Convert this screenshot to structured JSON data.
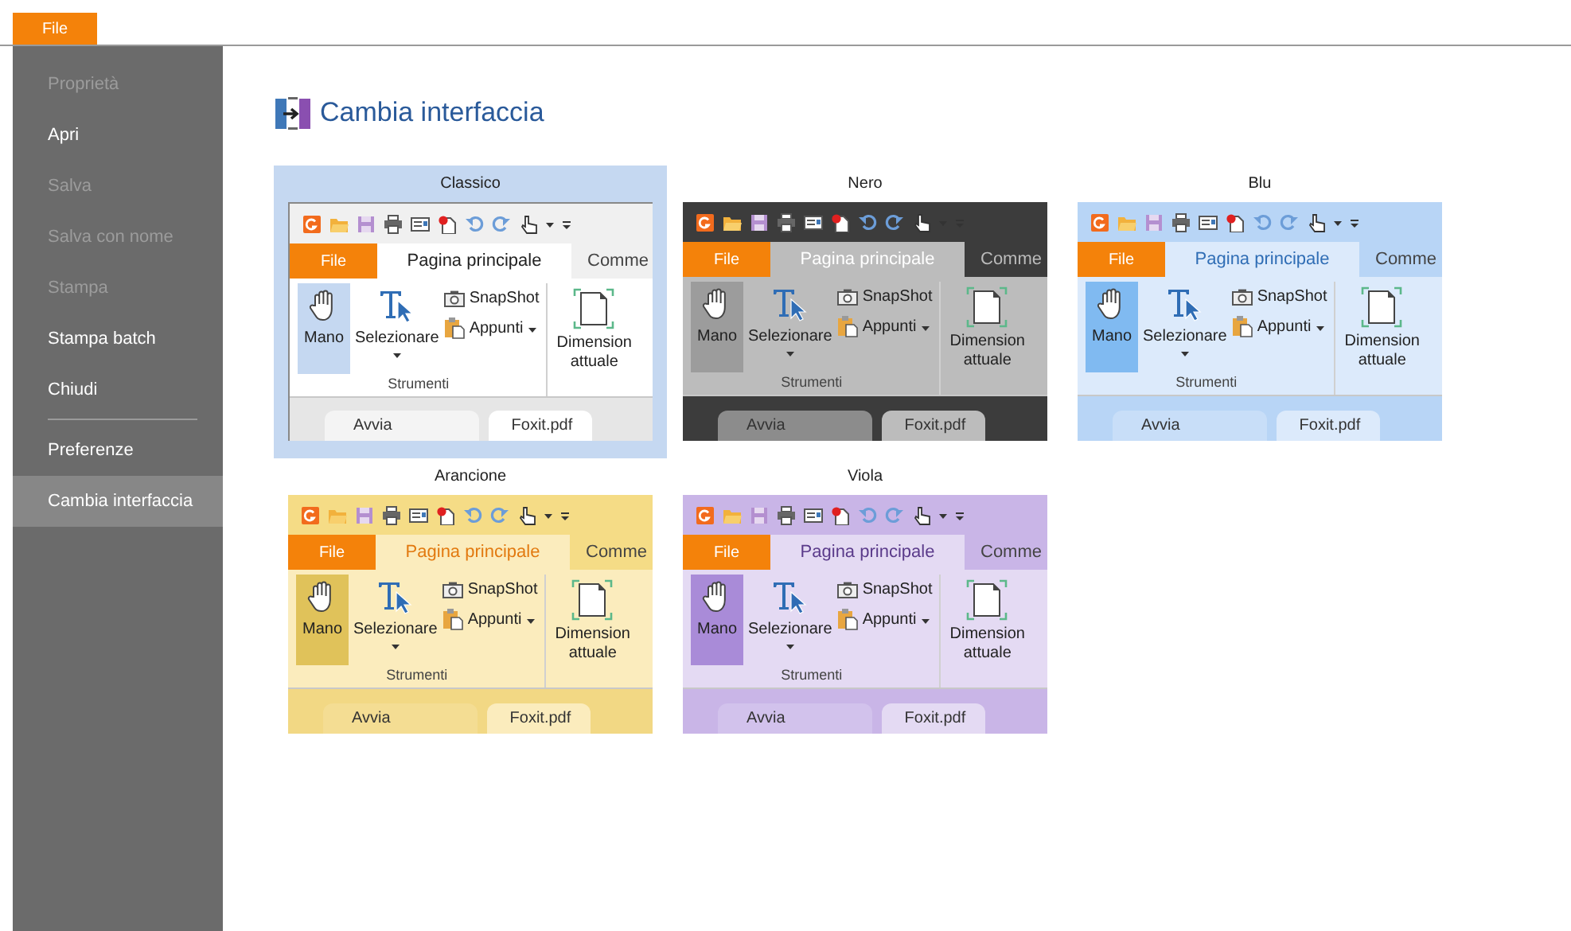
{
  "menu_tab": {
    "label": "File"
  },
  "sidebar": {
    "items": [
      {
        "label": "Proprietà",
        "disabled": true,
        "selected": false,
        "divider_before": false
      },
      {
        "label": "Apri",
        "disabled": false,
        "selected": false,
        "divider_before": false
      },
      {
        "label": "Salva",
        "disabled": true,
        "selected": false,
        "divider_before": false
      },
      {
        "label": "Salva con nome",
        "disabled": true,
        "selected": false,
        "divider_before": false
      },
      {
        "label": "Stampa",
        "disabled": true,
        "selected": false,
        "divider_before": false
      },
      {
        "label": "Stampa batch",
        "disabled": false,
        "selected": false,
        "divider_before": false
      },
      {
        "label": "Chiudi",
        "disabled": false,
        "selected": false,
        "divider_before": false
      },
      {
        "label": "Preferenze",
        "disabled": false,
        "selected": false,
        "divider_before": true
      },
      {
        "label": "Cambia interfaccia",
        "disabled": false,
        "selected": true,
        "divider_before": false
      }
    ]
  },
  "page_title": "Cambia interfaccia",
  "themes": [
    {
      "name": "Classico",
      "kind": "classic",
      "selected": true,
      "preview": {
        "file_tab": "File",
        "home_tab": "Pagina principale",
        "next_tab": "Comme",
        "hand": "Mano",
        "select": "Selezionare",
        "snapshot": "SnapShot",
        "clipboard": "Appunti",
        "group": "Strumenti",
        "actual_size": "Dimension\nattuale",
        "doc_tabs": [
          "Avvia",
          "Foxit.pdf"
        ]
      }
    },
    {
      "name": "Nero",
      "kind": "black",
      "selected": false,
      "preview": {
        "file_tab": "File",
        "home_tab": "Pagina principale",
        "next_tab": "Comme",
        "hand": "Mano",
        "select": "Selezionare",
        "snapshot": "SnapShot",
        "clipboard": "Appunti",
        "group": "Strumenti",
        "actual_size": "Dimension\nattuale",
        "doc_tabs": [
          "Avvia",
          "Foxit.pdf"
        ]
      }
    },
    {
      "name": "Blu",
      "kind": "blue",
      "selected": false,
      "preview": {
        "file_tab": "File",
        "home_tab": "Pagina principale",
        "next_tab": "Comme",
        "hand": "Mano",
        "select": "Selezionare",
        "snapshot": "SnapShot",
        "clipboard": "Appunti",
        "group": "Strumenti",
        "actual_size": "Dimension\nattuale",
        "doc_tabs": [
          "Avvia",
          "Foxit.pdf"
        ]
      }
    },
    {
      "name": "Arancione",
      "kind": "orange",
      "selected": false,
      "preview": {
        "file_tab": "File",
        "home_tab": "Pagina principale",
        "next_tab": "Comme",
        "hand": "Mano",
        "select": "Selezionare",
        "snapshot": "SnapShot",
        "clipboard": "Appunti",
        "group": "Strumenti",
        "actual_size": "Dimension\nattuale",
        "doc_tabs": [
          "Avvia",
          "Foxit.pdf"
        ]
      }
    },
    {
      "name": "Viola",
      "kind": "purple",
      "selected": false,
      "preview": {
        "file_tab": "File",
        "home_tab": "Pagina principale",
        "next_tab": "Comme",
        "hand": "Mano",
        "select": "Selezionare",
        "snapshot": "SnapShot",
        "clipboard": "Appunti",
        "group": "Strumenti",
        "actual_size": "Dimension\nattuale",
        "doc_tabs": [
          "Avvia",
          "Foxit.pdf"
        ]
      }
    }
  ]
}
